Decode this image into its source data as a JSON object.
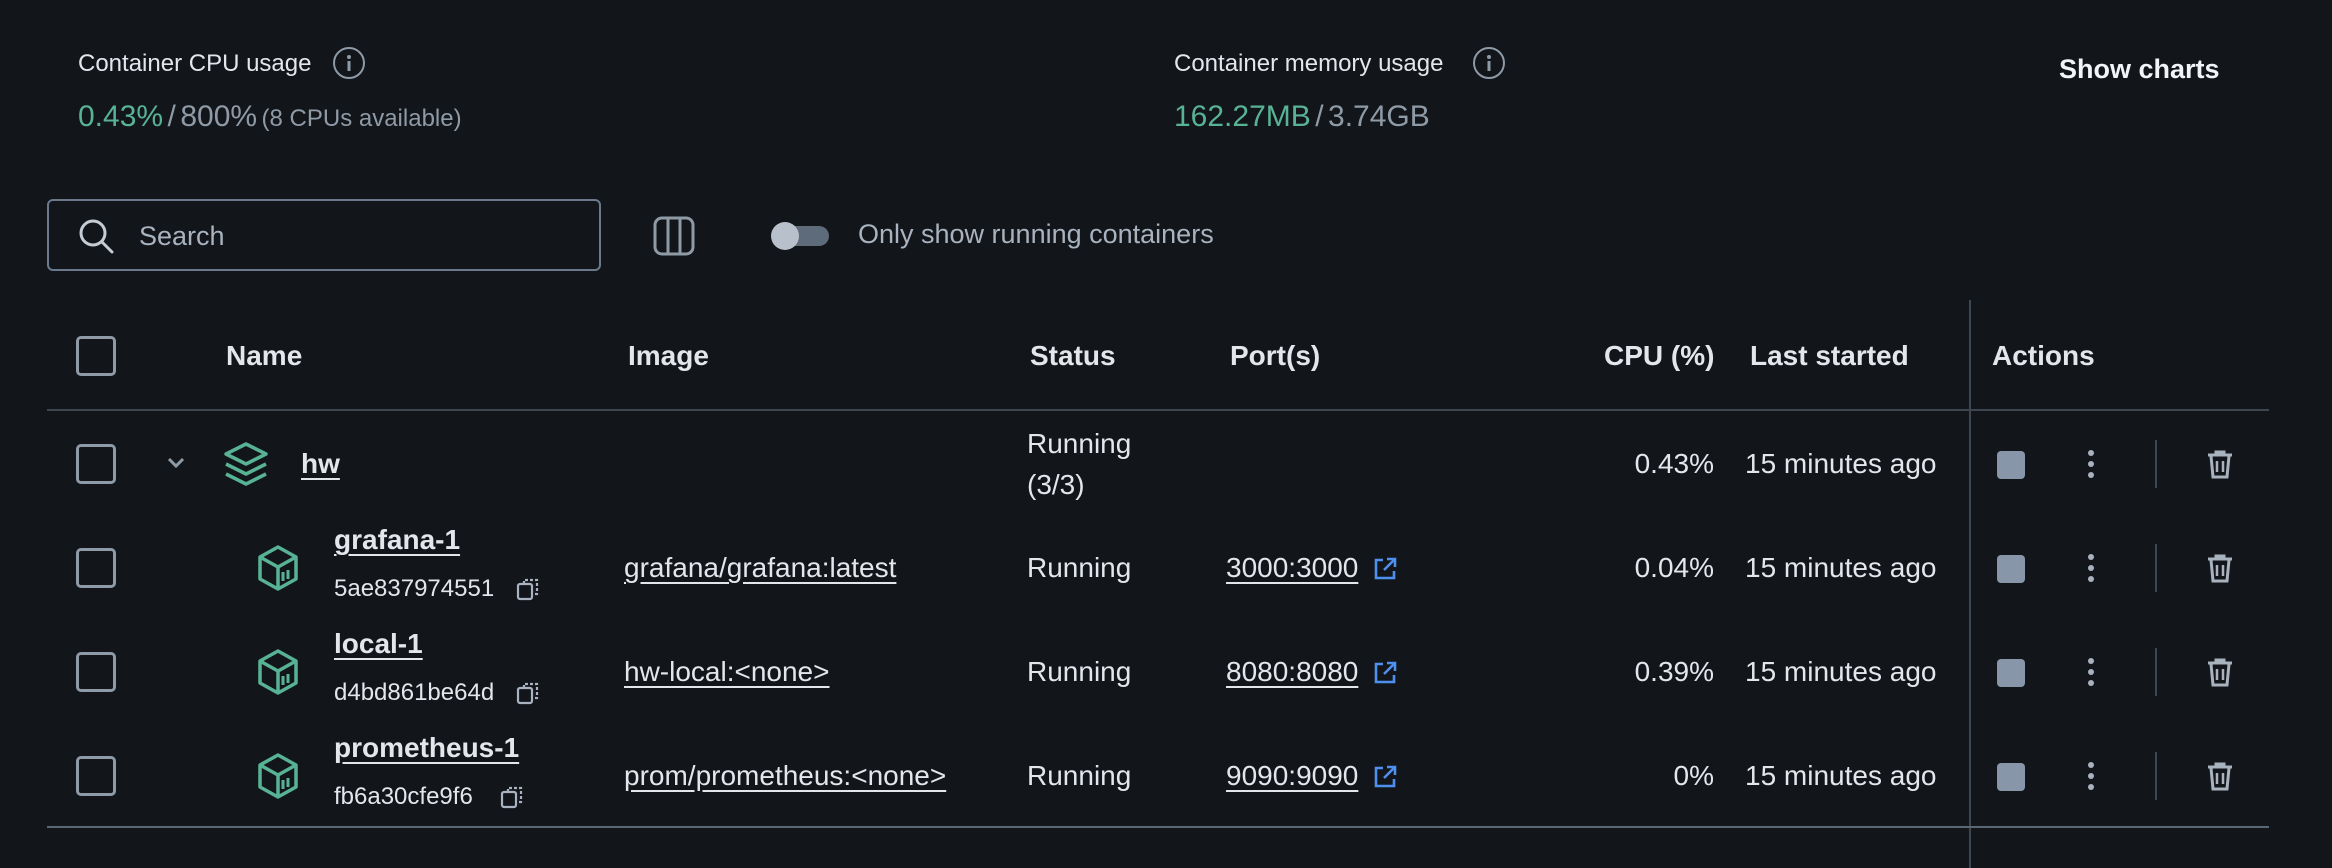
{
  "stats": {
    "cpu": {
      "title": "Container CPU usage",
      "used": "0.43%",
      "separator": "/",
      "total": "800%",
      "note": "(8 CPUs available)"
    },
    "memory": {
      "title": "Container memory usage",
      "used": "162.27MB",
      "separator": "/",
      "total": "3.74GB"
    },
    "show_charts_label": "Show charts"
  },
  "search": {
    "placeholder": "Search",
    "value": ""
  },
  "filter": {
    "label": "Only show running containers",
    "enabled": false
  },
  "columns": {
    "name": "Name",
    "image": "Image",
    "status": "Status",
    "ports": "Port(s)",
    "cpu": "CPU (%)",
    "last_started": "Last started",
    "actions": "Actions"
  },
  "group": {
    "name": "hw",
    "status_line1": "Running",
    "status_line2": "(3/3)",
    "cpu": "0.43%",
    "last_started": "15 minutes ago"
  },
  "containers": [
    {
      "name": "grafana-1",
      "id": "5ae837974551",
      "image": "grafana/grafana:latest",
      "status": "Running",
      "port": "3000:3000",
      "cpu": "0.04%",
      "last_started": "15 minutes ago"
    },
    {
      "name": "local-1",
      "id": "d4bd861be64d",
      "image": "hw-local:<none>",
      "status": "Running",
      "port": "8080:8080",
      "cpu": "0.39%",
      "last_started": "15 minutes ago"
    },
    {
      "name": "prometheus-1",
      "id": "fb6a30cfe9f6",
      "image": "prom/prometheus:<none>",
      "status": "Running",
      "port": "9090:9090",
      "cpu": "0%",
      "last_started": "15 minutes ago"
    }
  ],
  "colors": {
    "accent_green": "#58b394",
    "link_blue": "#4f8ff0",
    "background": "#12151a"
  }
}
